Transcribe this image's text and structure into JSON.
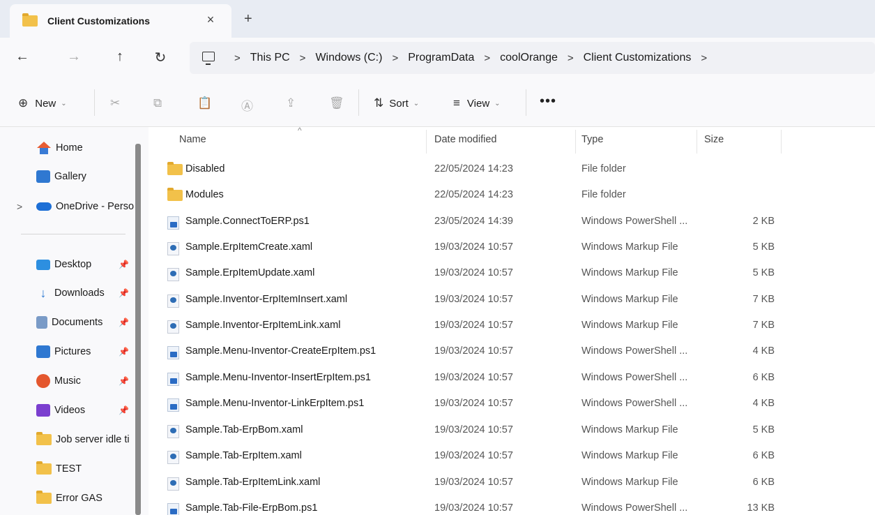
{
  "window": {
    "tab_title": "Client Customizations",
    "close_glyph": "×",
    "new_tab_glyph": "+"
  },
  "nav": {
    "back": "←",
    "forward": "→",
    "up": "↑",
    "refresh": "↻"
  },
  "breadcrumb": [
    "This PC",
    "Windows (C:)",
    "ProgramData",
    "coolOrange",
    "Client Customizations"
  ],
  "breadcrumb_sep": ">",
  "toolbar": {
    "new_label": "New",
    "sort_label": "Sort",
    "view_label": "View",
    "more_glyph": "•••",
    "chevron": "⌄"
  },
  "sidebar": {
    "expander": ">",
    "pin_glyph": "📌",
    "items": [
      {
        "label": "Home",
        "icon": "home-icon"
      },
      {
        "label": "Gallery",
        "icon": "gallery-icon"
      },
      {
        "label": "OneDrive - Perso",
        "icon": "onedrive-icon"
      },
      {
        "label": "Desktop",
        "icon": "desktop-icon",
        "pinned": true
      },
      {
        "label": "Downloads",
        "icon": "downloads-icon",
        "pinned": true
      },
      {
        "label": "Documents",
        "icon": "documents-icon",
        "pinned": true
      },
      {
        "label": "Pictures",
        "icon": "pictures-icon",
        "pinned": true
      },
      {
        "label": "Music",
        "icon": "music-icon",
        "pinned": true
      },
      {
        "label": "Videos",
        "icon": "videos-icon",
        "pinned": true
      },
      {
        "label": "Job server idle ti",
        "icon": "folder-icon"
      },
      {
        "label": "TEST",
        "icon": "folder-icon"
      },
      {
        "label": "Error GAS",
        "icon": "folder-icon"
      }
    ]
  },
  "columns": {
    "name": "Name",
    "date": "Date modified",
    "type": "Type",
    "size": "Size",
    "sort_caret": "^"
  },
  "files": [
    {
      "name": "Disabled",
      "date": "22/05/2024 14:23",
      "type": "File folder",
      "size": "",
      "icon": "folder-icon"
    },
    {
      "name": "Modules",
      "date": "22/05/2024 14:23",
      "type": "File folder",
      "size": "",
      "icon": "folder-icon"
    },
    {
      "name": "Sample.ConnectToERP.ps1",
      "date": "23/05/2024 14:39",
      "type": "Windows PowerShell ...",
      "size": "2 KB",
      "icon": "powershell-file-icon"
    },
    {
      "name": "Sample.ErpItemCreate.xaml",
      "date": "19/03/2024 10:57",
      "type": "Windows Markup File",
      "size": "5 KB",
      "icon": "xaml-file-icon"
    },
    {
      "name": "Sample.ErpItemUpdate.xaml",
      "date": "19/03/2024 10:57",
      "type": "Windows Markup File",
      "size": "5 KB",
      "icon": "xaml-file-icon"
    },
    {
      "name": "Sample.Inventor-ErpItemInsert.xaml",
      "date": "19/03/2024 10:57",
      "type": "Windows Markup File",
      "size": "7 KB",
      "icon": "xaml-file-icon"
    },
    {
      "name": "Sample.Inventor-ErpItemLink.xaml",
      "date": "19/03/2024 10:57",
      "type": "Windows Markup File",
      "size": "7 KB",
      "icon": "xaml-file-icon"
    },
    {
      "name": "Sample.Menu-Inventor-CreateErpItem.ps1",
      "date": "19/03/2024 10:57",
      "type": "Windows PowerShell ...",
      "size": "4 KB",
      "icon": "powershell-file-icon"
    },
    {
      "name": "Sample.Menu-Inventor-InsertErpItem.ps1",
      "date": "19/03/2024 10:57",
      "type": "Windows PowerShell ...",
      "size": "6 KB",
      "icon": "powershell-file-icon"
    },
    {
      "name": "Sample.Menu-Inventor-LinkErpItem.ps1",
      "date": "19/03/2024 10:57",
      "type": "Windows PowerShell ...",
      "size": "4 KB",
      "icon": "powershell-file-icon"
    },
    {
      "name": "Sample.Tab-ErpBom.xaml",
      "date": "19/03/2024 10:57",
      "type": "Windows Markup File",
      "size": "5 KB",
      "icon": "xaml-file-icon"
    },
    {
      "name": "Sample.Tab-ErpItem.xaml",
      "date": "19/03/2024 10:57",
      "type": "Windows Markup File",
      "size": "6 KB",
      "icon": "xaml-file-icon"
    },
    {
      "name": "Sample.Tab-ErpItemLink.xaml",
      "date": "19/03/2024 10:57",
      "type": "Windows Markup File",
      "size": "6 KB",
      "icon": "xaml-file-icon"
    },
    {
      "name": "Sample.Tab-File-ErpBom.ps1",
      "date": "19/03/2024 10:57",
      "type": "Windows PowerShell ...",
      "size": "13 KB",
      "icon": "powershell-file-icon"
    }
  ],
  "colors": {
    "folder": "#f2c14a",
    "accent": "#1d6fd6",
    "titlebar": "#e8ecf3"
  }
}
